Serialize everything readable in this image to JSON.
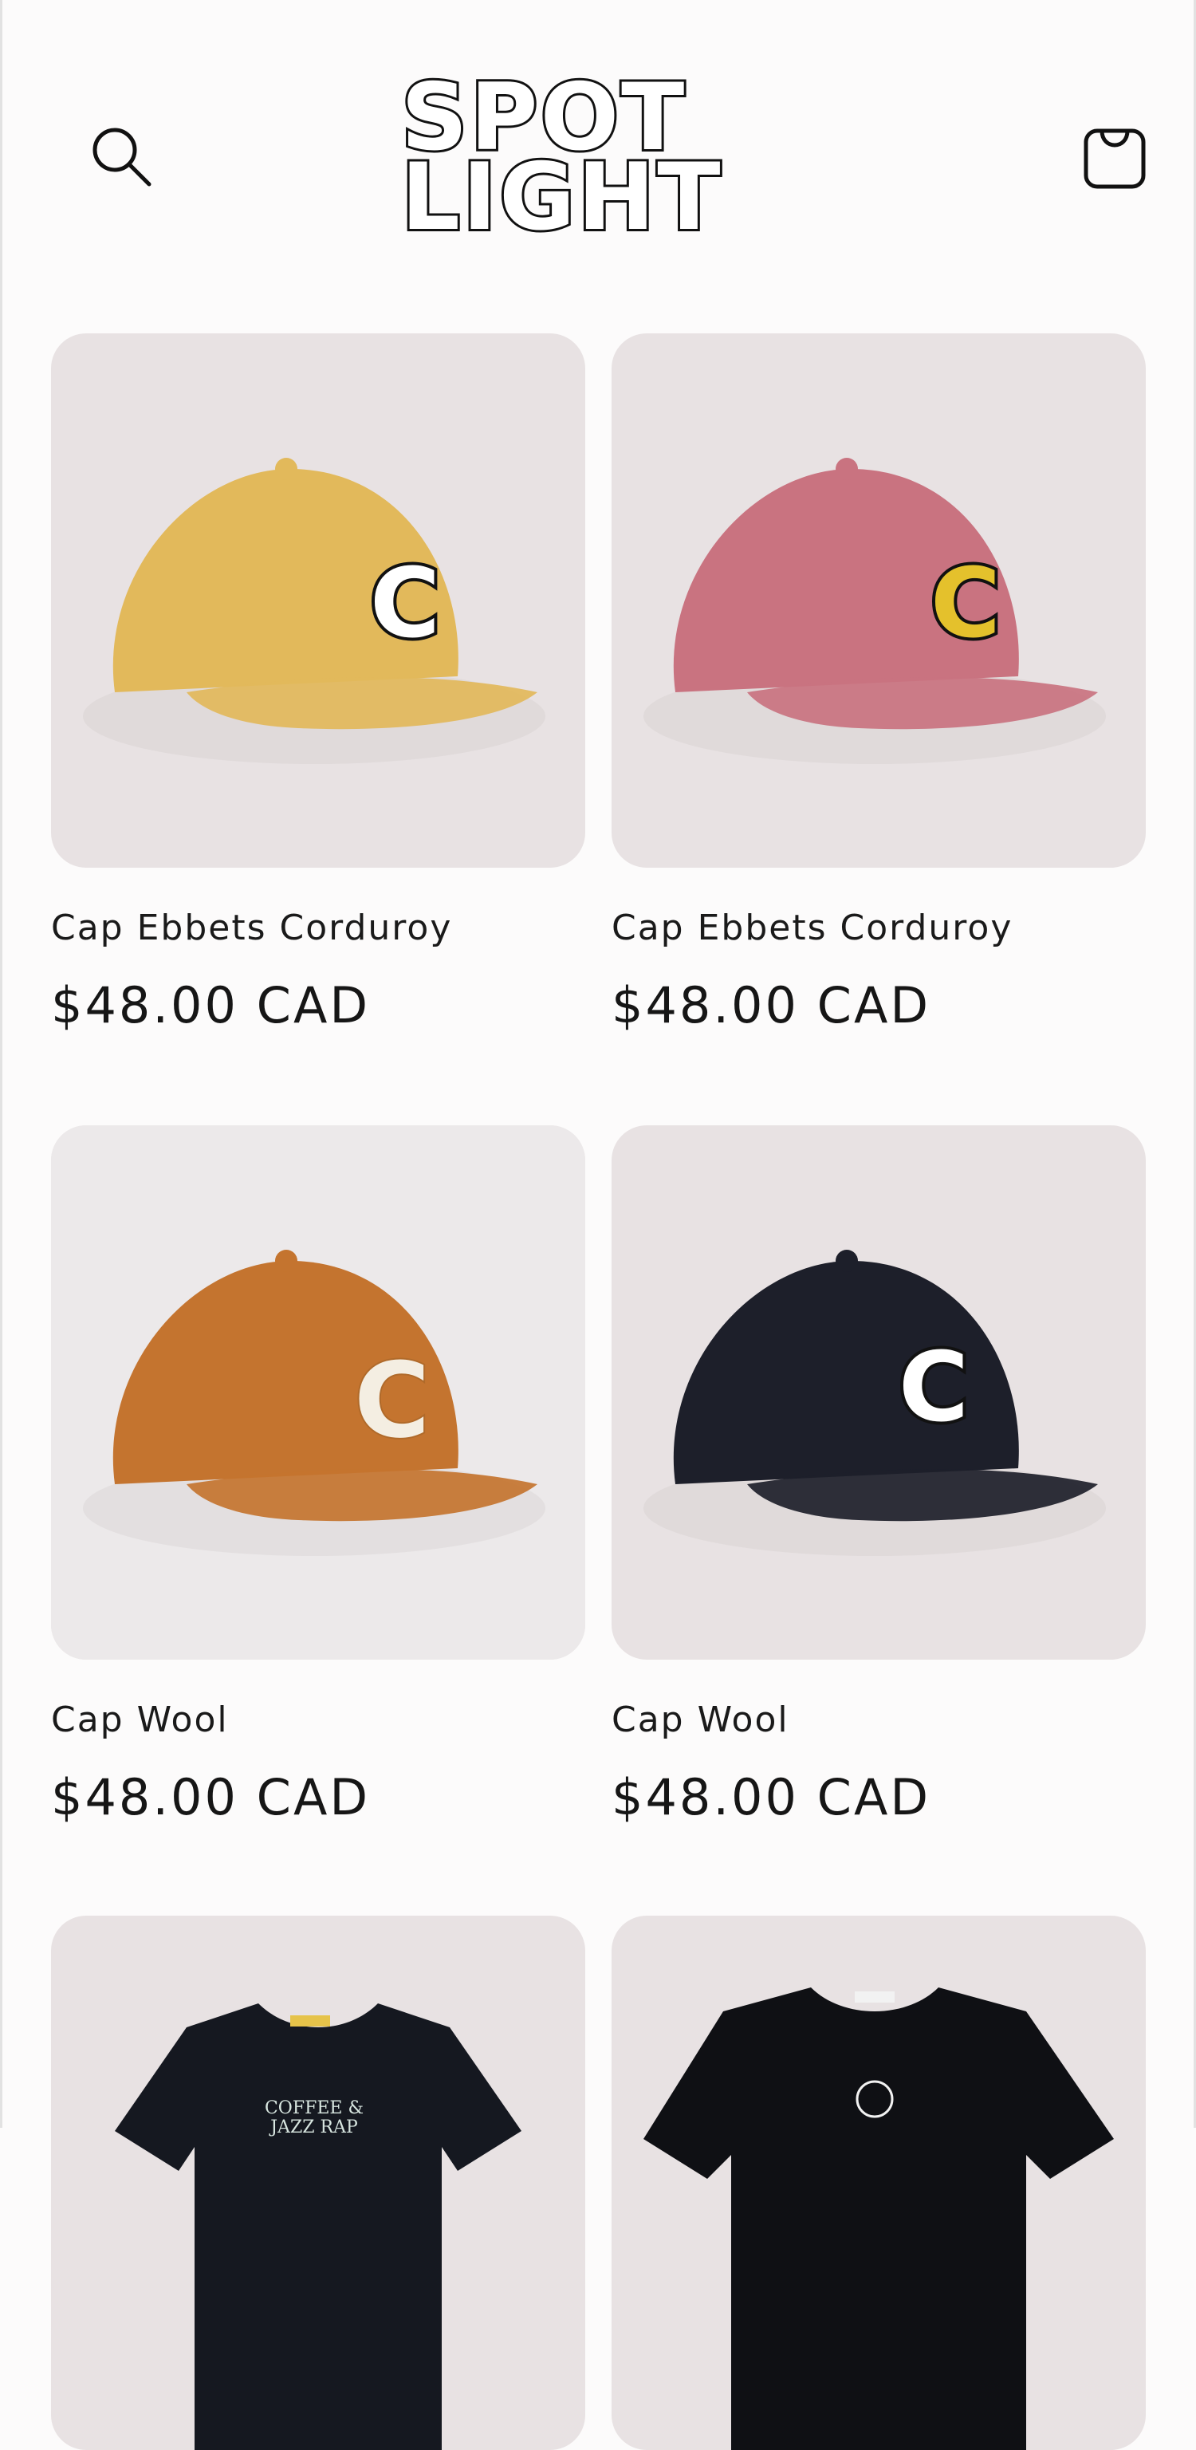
{
  "header": {
    "logo_line1": "SPOT",
    "logo_line2": "LIGHT",
    "search_icon": "search-icon",
    "cart_icon": "shopping-bag-icon"
  },
  "products": [
    {
      "title": "Cap Ebbets Corduroy",
      "price": "$48.00 CAD",
      "color": "#e2b95b"
    },
    {
      "title": "Cap Ebbets Corduroy",
      "price": "$48.00 CAD",
      "color": "#c97380"
    },
    {
      "title": "Cap Wool",
      "price": "$48.00 CAD",
      "color": "#c4742f"
    },
    {
      "title": "Cap Wool",
      "price": "$48.00 CAD",
      "color": "#1d1f2a"
    },
    {
      "title": "",
      "price": "",
      "color": "#151820"
    },
    {
      "title": "",
      "price": "",
      "color": "#0f1014"
    }
  ],
  "colors": {
    "page_bg": "#fcfbfb",
    "image_bg": "#e8e2e3",
    "text": "#121212"
  }
}
